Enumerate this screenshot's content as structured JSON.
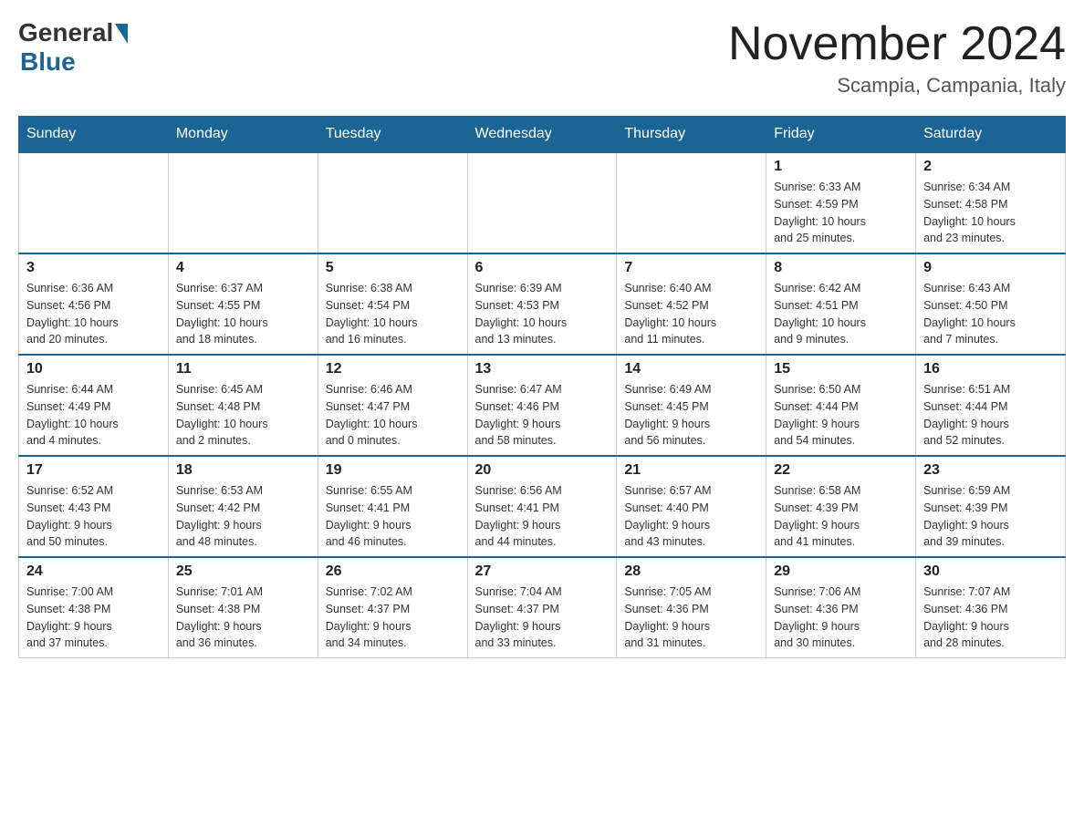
{
  "header": {
    "logo_general": "General",
    "logo_blue": "Blue",
    "month_title": "November 2024",
    "location": "Scampia, Campania, Italy"
  },
  "days_of_week": [
    "Sunday",
    "Monday",
    "Tuesday",
    "Wednesday",
    "Thursday",
    "Friday",
    "Saturday"
  ],
  "weeks": [
    [
      {
        "day": "",
        "info": ""
      },
      {
        "day": "",
        "info": ""
      },
      {
        "day": "",
        "info": ""
      },
      {
        "day": "",
        "info": ""
      },
      {
        "day": "",
        "info": ""
      },
      {
        "day": "1",
        "info": "Sunrise: 6:33 AM\nSunset: 4:59 PM\nDaylight: 10 hours\nand 25 minutes."
      },
      {
        "day": "2",
        "info": "Sunrise: 6:34 AM\nSunset: 4:58 PM\nDaylight: 10 hours\nand 23 minutes."
      }
    ],
    [
      {
        "day": "3",
        "info": "Sunrise: 6:36 AM\nSunset: 4:56 PM\nDaylight: 10 hours\nand 20 minutes."
      },
      {
        "day": "4",
        "info": "Sunrise: 6:37 AM\nSunset: 4:55 PM\nDaylight: 10 hours\nand 18 minutes."
      },
      {
        "day": "5",
        "info": "Sunrise: 6:38 AM\nSunset: 4:54 PM\nDaylight: 10 hours\nand 16 minutes."
      },
      {
        "day": "6",
        "info": "Sunrise: 6:39 AM\nSunset: 4:53 PM\nDaylight: 10 hours\nand 13 minutes."
      },
      {
        "day": "7",
        "info": "Sunrise: 6:40 AM\nSunset: 4:52 PM\nDaylight: 10 hours\nand 11 minutes."
      },
      {
        "day": "8",
        "info": "Sunrise: 6:42 AM\nSunset: 4:51 PM\nDaylight: 10 hours\nand 9 minutes."
      },
      {
        "day": "9",
        "info": "Sunrise: 6:43 AM\nSunset: 4:50 PM\nDaylight: 10 hours\nand 7 minutes."
      }
    ],
    [
      {
        "day": "10",
        "info": "Sunrise: 6:44 AM\nSunset: 4:49 PM\nDaylight: 10 hours\nand 4 minutes."
      },
      {
        "day": "11",
        "info": "Sunrise: 6:45 AM\nSunset: 4:48 PM\nDaylight: 10 hours\nand 2 minutes."
      },
      {
        "day": "12",
        "info": "Sunrise: 6:46 AM\nSunset: 4:47 PM\nDaylight: 10 hours\nand 0 minutes."
      },
      {
        "day": "13",
        "info": "Sunrise: 6:47 AM\nSunset: 4:46 PM\nDaylight: 9 hours\nand 58 minutes."
      },
      {
        "day": "14",
        "info": "Sunrise: 6:49 AM\nSunset: 4:45 PM\nDaylight: 9 hours\nand 56 minutes."
      },
      {
        "day": "15",
        "info": "Sunrise: 6:50 AM\nSunset: 4:44 PM\nDaylight: 9 hours\nand 54 minutes."
      },
      {
        "day": "16",
        "info": "Sunrise: 6:51 AM\nSunset: 4:44 PM\nDaylight: 9 hours\nand 52 minutes."
      }
    ],
    [
      {
        "day": "17",
        "info": "Sunrise: 6:52 AM\nSunset: 4:43 PM\nDaylight: 9 hours\nand 50 minutes."
      },
      {
        "day": "18",
        "info": "Sunrise: 6:53 AM\nSunset: 4:42 PM\nDaylight: 9 hours\nand 48 minutes."
      },
      {
        "day": "19",
        "info": "Sunrise: 6:55 AM\nSunset: 4:41 PM\nDaylight: 9 hours\nand 46 minutes."
      },
      {
        "day": "20",
        "info": "Sunrise: 6:56 AM\nSunset: 4:41 PM\nDaylight: 9 hours\nand 44 minutes."
      },
      {
        "day": "21",
        "info": "Sunrise: 6:57 AM\nSunset: 4:40 PM\nDaylight: 9 hours\nand 43 minutes."
      },
      {
        "day": "22",
        "info": "Sunrise: 6:58 AM\nSunset: 4:39 PM\nDaylight: 9 hours\nand 41 minutes."
      },
      {
        "day": "23",
        "info": "Sunrise: 6:59 AM\nSunset: 4:39 PM\nDaylight: 9 hours\nand 39 minutes."
      }
    ],
    [
      {
        "day": "24",
        "info": "Sunrise: 7:00 AM\nSunset: 4:38 PM\nDaylight: 9 hours\nand 37 minutes."
      },
      {
        "day": "25",
        "info": "Sunrise: 7:01 AM\nSunset: 4:38 PM\nDaylight: 9 hours\nand 36 minutes."
      },
      {
        "day": "26",
        "info": "Sunrise: 7:02 AM\nSunset: 4:37 PM\nDaylight: 9 hours\nand 34 minutes."
      },
      {
        "day": "27",
        "info": "Sunrise: 7:04 AM\nSunset: 4:37 PM\nDaylight: 9 hours\nand 33 minutes."
      },
      {
        "day": "28",
        "info": "Sunrise: 7:05 AM\nSunset: 4:36 PM\nDaylight: 9 hours\nand 31 minutes."
      },
      {
        "day": "29",
        "info": "Sunrise: 7:06 AM\nSunset: 4:36 PM\nDaylight: 9 hours\nand 30 minutes."
      },
      {
        "day": "30",
        "info": "Sunrise: 7:07 AM\nSunset: 4:36 PM\nDaylight: 9 hours\nand 28 minutes."
      }
    ]
  ]
}
